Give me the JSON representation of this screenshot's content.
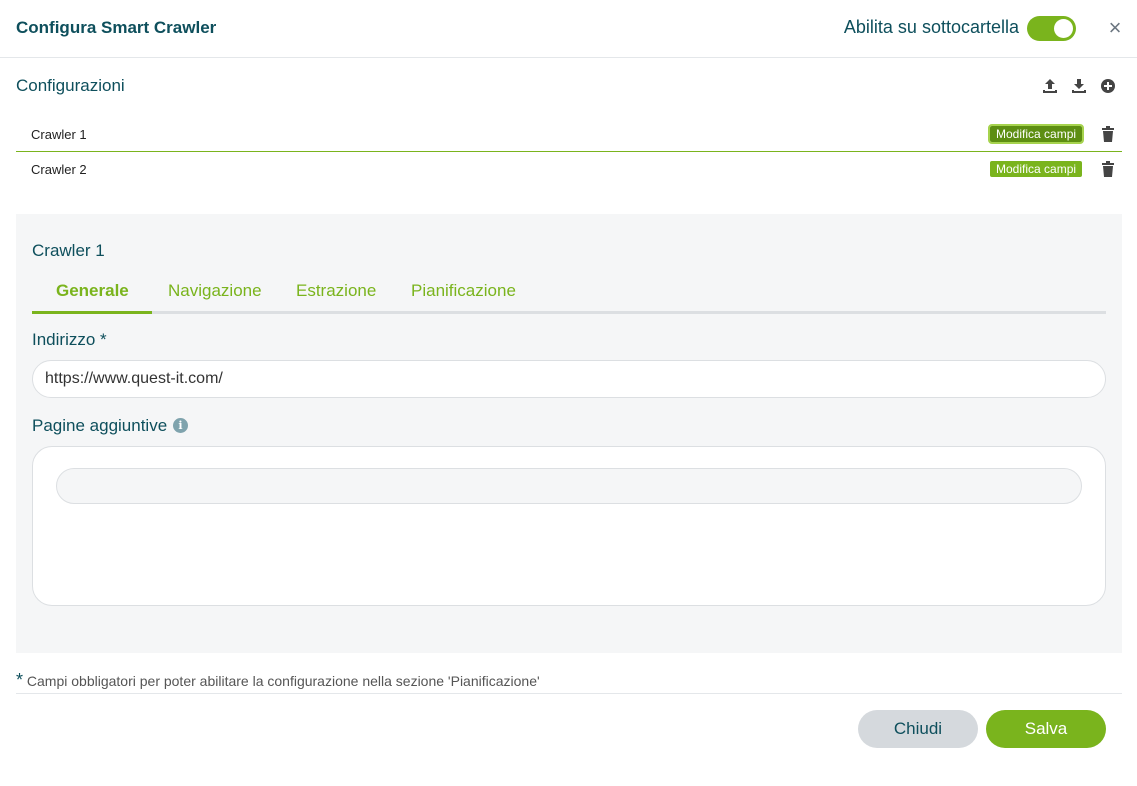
{
  "header": {
    "title": "Configura Smart Crawler",
    "toggle_label": "Abilita su sottocartella",
    "toggle_on": true
  },
  "configurations": {
    "title": "Configurazioni",
    "icons": [
      "upload-icon",
      "download-icon",
      "add-circle-icon"
    ],
    "items": [
      {
        "name": "Crawler 1",
        "edit_label": "Modifica campi"
      },
      {
        "name": "Crawler 2",
        "edit_label": "Modifica campi"
      }
    ]
  },
  "detail": {
    "title": "Crawler 1",
    "tabs": [
      "Generale",
      "Navigazione",
      "Estrazione",
      "Pianificazione"
    ],
    "active_tab": "Generale",
    "address_label": "Indirizzo *",
    "address_value": "https://www.quest-it.com/",
    "extra_pages_label": "Pagine aggiuntive",
    "extra_pages_value": ""
  },
  "footer": {
    "note_star": "*",
    "note": "Campi obbligatori per poter abilitare la configurazione nella sezione 'Pianificazione'",
    "close_label": "Chiudi",
    "save_label": "Salva"
  },
  "colors": {
    "accent": "#7ab41d",
    "title": "#0e4f5c",
    "panel_bg": "#f5f6f7"
  }
}
